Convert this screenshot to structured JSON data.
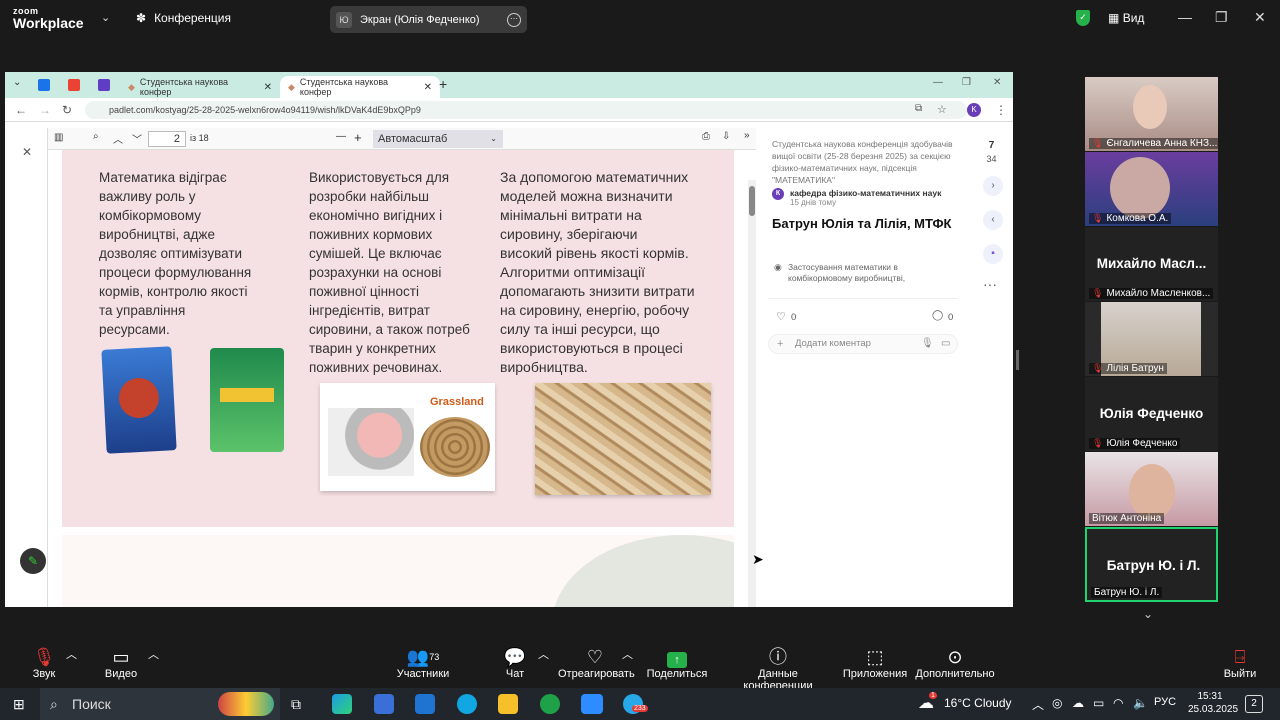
{
  "zoom": {
    "logo_line1": "zoom",
    "logo_line2": "Workplace",
    "meeting_label": "Конференция",
    "screen_avatar": "Ю",
    "screen_share_label": "Экран (Юлія Федченко)",
    "view_label": "Вид"
  },
  "browser": {
    "tabs": [
      {
        "label": "Студентська наукова конфер"
      },
      {
        "label": "Студентська наукова конфер"
      }
    ],
    "new_tab": "+",
    "url": "padlet.com/kostyag/25-28-2025-welxn6row4o94119/wish/lkDVaK4dE9bxQPp9",
    "profile_initial": "K"
  },
  "pdf": {
    "page_current": "2",
    "page_total": "із 18",
    "zoom_option": "Автомасштаб",
    "col1": "   Математика відіграє\nважливу роль у\nкомбікормовому\nвиробництві, адже\nдозволяє оптимізувати\nпроцеси формулювання\nкормів, контролю якості\nта управління\nресурсами.",
    "col2": "   Використовується для\nрозробки найбільш\nекономічно вигідних і\nпоживних кормових\nсумішей. Це включає\nрозрахунки на основі\nпоживної цінності\nінгредієнтів, витрат\nсировини, а також потреб\nтварин у конкретних\nпоживних речовинах.",
    "col3": "   За допомогою математичних\nмоделей можна визначити\nмінімальні витрати на\nсировину, зберігаючи\nвисокий рівень якості кормів.\nАлгоритми оптимізації\nдопомагають знизити витрати\nна сировину, енергію, робочу\nсилу та інші ресурси, що\nвикористовуються в процесі\nвиробництва.",
    "grassland_label": "Grassland"
  },
  "padlet": {
    "header_text": "Студентська наукова конференція здобувачів вищої освіти (25-28 березня 2025) за секцією фізико-математичних наук, підсекція \"МАТЕМАТИКА\"",
    "author_initial": "К",
    "author": "кафедра фізико-математичних наук",
    "posted": "15 днів тому",
    "title": "Батрун Юлія та Лілія, МТФК",
    "attachment": "Застосування математики в комбікормовому виробництві,",
    "likes": "0",
    "comments": "0",
    "comment_placeholder": "Додати коментар",
    "nav_count_top": "7",
    "nav_count_bottom": "34"
  },
  "participants": [
    {
      "name": "Єнгаличева Анна КНЗ..."
    },
    {
      "name": "Комкова О.А."
    },
    {
      "big": "Михайло  Масл...",
      "name": "Михайло Масленков..."
    },
    {
      "name": "Лілія Батрун"
    },
    {
      "big": "Юлія Федченко",
      "name": "Юлія Федченко"
    },
    {
      "name": "Вітюк Антоніна"
    },
    {
      "big": "Батрун Ю. і Л.",
      "name": "Батрун Ю. і Л."
    }
  ],
  "controls": {
    "audio": "Звук",
    "video": "Видео",
    "participants": "Участники",
    "participants_count": "73",
    "chat": "Чат",
    "react": "Отреагировать",
    "share": "Поделиться",
    "info": "Данные конференции",
    "apps": "Приложения",
    "more": "Дополнительно",
    "leave": "Выйти"
  },
  "taskbar": {
    "search": "Поиск",
    "weather": "16°C  Cloudy",
    "lang": "РУС",
    "time": "15:31",
    "date": "25.03.2025",
    "notif": "2",
    "telegram_badge": "233",
    "weather_badge": "1"
  },
  "colors": {
    "accent_green": "#25b24a",
    "slide_bg": "#f5e1e4",
    "tab_bg": "#c9ebe2",
    "active_speaker": "#1fd36e"
  }
}
